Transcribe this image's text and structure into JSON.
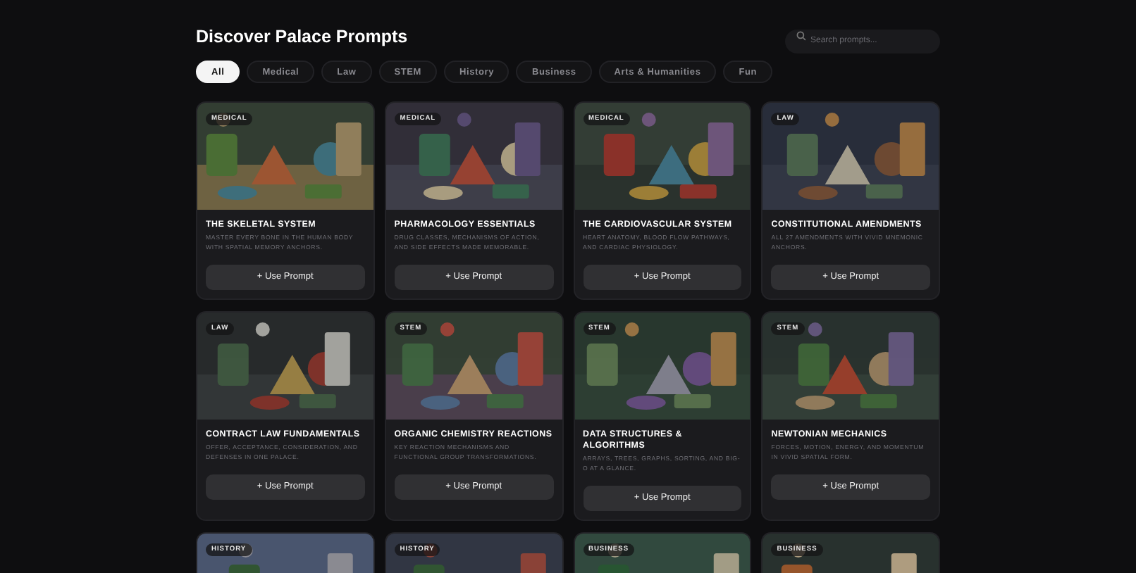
{
  "title": "Discover Palace Prompts",
  "search": {
    "placeholder": "Search prompts..."
  },
  "filters": [
    {
      "label": "All",
      "selected": true
    },
    {
      "label": "Medical",
      "selected": false
    },
    {
      "label": "Law",
      "selected": false
    },
    {
      "label": "STEM",
      "selected": false
    },
    {
      "label": "History",
      "selected": false
    },
    {
      "label": "Business",
      "selected": false
    },
    {
      "label": "Arts & Humanities",
      "selected": false
    },
    {
      "label": "Fun",
      "selected": false
    }
  ],
  "cards": [
    {
      "category": "MEDICAL",
      "title": "THE SKELETAL SYSTEM",
      "description": "MASTER EVERY BONE IN THE HUMAN BODY WITH SPATIAL MEMORY ANCHORS.",
      "button": "+ Use Prompt"
    },
    {
      "category": "MEDICAL",
      "title": "PHARMACOLOGY ESSENTIALS",
      "description": "DRUG CLASSES, MECHANISMS OF ACTION, AND SIDE EFFECTS MADE MEMORABLE.",
      "button": "+ Use Prompt"
    },
    {
      "category": "MEDICAL",
      "title": "THE CARDIOVASCULAR SYSTEM",
      "description": "HEART ANATOMY, BLOOD FLOW PATHWAYS, AND CARDIAC PHYSIOLOGY.",
      "button": "+ Use Prompt"
    },
    {
      "category": "LAW",
      "title": "CONSTITUTIONAL AMENDMENTS",
      "description": "ALL 27 AMENDMENTS WITH VIVID MNEMONIC ANCHORS.",
      "button": "+ Use Prompt"
    },
    {
      "category": "LAW",
      "title": "CONTRACT LAW FUNDAMENTALS",
      "description": "OFFER, ACCEPTANCE, CONSIDERATION, AND DEFENSES IN ONE PALACE.",
      "button": "+ Use Prompt"
    },
    {
      "category": "STEM",
      "title": "ORGANIC CHEMISTRY REACTIONS",
      "description": "KEY REACTION MECHANISMS AND FUNCTIONAL GROUP TRANSFORMATIONS.",
      "button": "+ Use Prompt"
    },
    {
      "category": "STEM",
      "title": "DATA STRUCTURES & ALGORITHMS",
      "description": "ARRAYS, TREES, GRAPHS, SORTING, AND BIG-O AT A GLANCE.",
      "button": "+ Use Prompt"
    },
    {
      "category": "STEM",
      "title": "NEWTONIAN MECHANICS",
      "description": "FORCES, MOTION, ENERGY, AND MOMENTUM IN VIVID SPATIAL FORM.",
      "button": "+ Use Prompt"
    },
    {
      "category": "HISTORY"
    },
    {
      "category": "HISTORY"
    },
    {
      "category": "BUSINESS"
    },
    {
      "category": "BUSINESS"
    }
  ]
}
